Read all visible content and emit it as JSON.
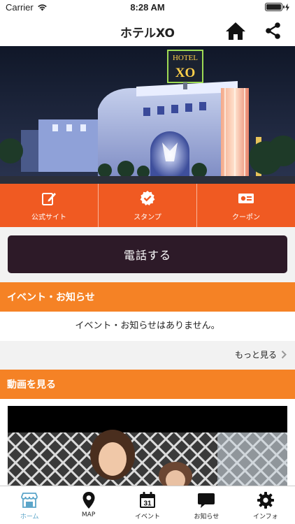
{
  "status": {
    "carrier": "Carrier",
    "time": "8:28 AM"
  },
  "header": {
    "title": "ホテルXO"
  },
  "hero": {
    "sign_top": "HOTEL",
    "sign_main": "XO"
  },
  "actions": [
    {
      "label": "公式サイト",
      "icon": "edit-icon"
    },
    {
      "label": "スタンプ",
      "icon": "stamp-check-icon"
    },
    {
      "label": "クーポン",
      "icon": "coupon-icon"
    }
  ],
  "call_label": "電話する",
  "events": {
    "title": "イベント・お知らせ",
    "empty_message": "イベント・お知らせはありません。",
    "more_label": "もっと見る"
  },
  "video": {
    "title": "動画を見る"
  },
  "tabs": [
    {
      "label": "ホーム",
      "icon": "home-icon",
      "active": true
    },
    {
      "label": "MAP",
      "icon": "map-pin-icon",
      "active": false
    },
    {
      "label": "イベント",
      "icon": "calendar-icon",
      "active": false,
      "badge": "31"
    },
    {
      "label": "お知らせ",
      "icon": "chat-bubble-icon",
      "active": false
    },
    {
      "label": "インフォ",
      "icon": "gear-icon",
      "active": false
    }
  ],
  "colors": {
    "accent_orange": "#f05a22",
    "section_orange": "#f58225",
    "call_button": "#2d1a28",
    "tab_active": "#5ba5c9"
  }
}
